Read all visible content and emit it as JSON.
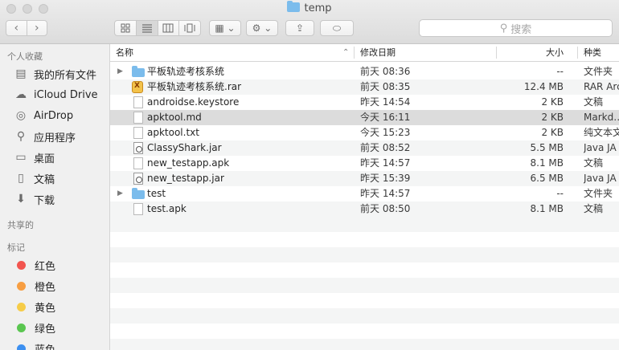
{
  "window": {
    "title": "temp"
  },
  "toolbar": {
    "back_glyph": "‹",
    "forward_glyph": "›",
    "view_icons": [
      "grid-view-icon",
      "list-view-icon",
      "column-view-icon",
      "cover-flow-icon"
    ],
    "arrange_glyph": "▦ ⌄",
    "action_glyph": "⚙ ⌄",
    "share_glyph": "⇪",
    "tag_glyph": "⬭",
    "search_placeholder": "搜索"
  },
  "sidebar": {
    "favorites_header": "个人收藏",
    "favorites": [
      {
        "label": "我的所有文件",
        "icon": "all-files-icon",
        "glyph": "▤"
      },
      {
        "label": "iCloud Drive",
        "icon": "cloud-icon",
        "glyph": "☁"
      },
      {
        "label": "AirDrop",
        "icon": "airdrop-icon",
        "glyph": "◎"
      },
      {
        "label": "应用程序",
        "icon": "applications-icon",
        "glyph": "⚲"
      },
      {
        "label": "桌面",
        "icon": "desktop-icon",
        "glyph": "▭"
      },
      {
        "label": "文稿",
        "icon": "documents-icon",
        "glyph": "▯"
      },
      {
        "label": "下载",
        "icon": "downloads-icon",
        "glyph": "⬇"
      }
    ],
    "shared_header": "共享的",
    "tags_header": "标记",
    "tags": [
      {
        "label": "红色",
        "color": "#f2554f"
      },
      {
        "label": "橙色",
        "color": "#f79e42"
      },
      {
        "label": "黄色",
        "color": "#f6cc48"
      },
      {
        "label": "绿色",
        "color": "#5ac650"
      },
      {
        "label": "蓝色",
        "color": "#3c8ff0"
      }
    ]
  },
  "columns": {
    "name": "名称",
    "date": "修改日期",
    "size": "大小",
    "kind": "种类",
    "sort_indicator": "⌃"
  },
  "files": [
    {
      "name": "平板轨迹考核系统",
      "date": "前天 08:36",
      "size": "--",
      "kind": "文件夹",
      "type": "folder",
      "expandable": true
    },
    {
      "name": "平板轨迹考核系统.rar",
      "date": "前天 08:35",
      "size": "12.4 MB",
      "kind": "RAR Arc",
      "type": "rar",
      "expandable": false
    },
    {
      "name": "androidse.keystore",
      "date": "昨天 14:54",
      "size": "2 KB",
      "kind": "文稿",
      "type": "doc",
      "expandable": false
    },
    {
      "name": "apktool.md",
      "date": "今天 16:11",
      "size": "2 KB",
      "kind": "Markd…",
      "type": "doc",
      "expandable": false,
      "selected": true
    },
    {
      "name": "apktool.txt",
      "date": "今天 15:23",
      "size": "2 KB",
      "kind": "纯文本文",
      "type": "doc",
      "expandable": false
    },
    {
      "name": "ClassyShark.jar",
      "date": "前天 08:52",
      "size": "5.5 MB",
      "kind": "Java JA",
      "type": "jar",
      "expandable": false
    },
    {
      "name": "new_testapp.apk",
      "date": "昨天 14:57",
      "size": "8.1 MB",
      "kind": "文稿",
      "type": "doc",
      "expandable": false
    },
    {
      "name": "new_testapp.jar",
      "date": "昨天 15:39",
      "size": "6.5 MB",
      "kind": "Java JA",
      "type": "jar",
      "expandable": false
    },
    {
      "name": "test",
      "date": "昨天 14:57",
      "size": "--",
      "kind": "文件夹",
      "type": "folder",
      "expandable": true
    },
    {
      "name": "test.apk",
      "date": "前天 08:50",
      "size": "8.1 MB",
      "kind": "文稿",
      "type": "doc",
      "expandable": false
    }
  ]
}
